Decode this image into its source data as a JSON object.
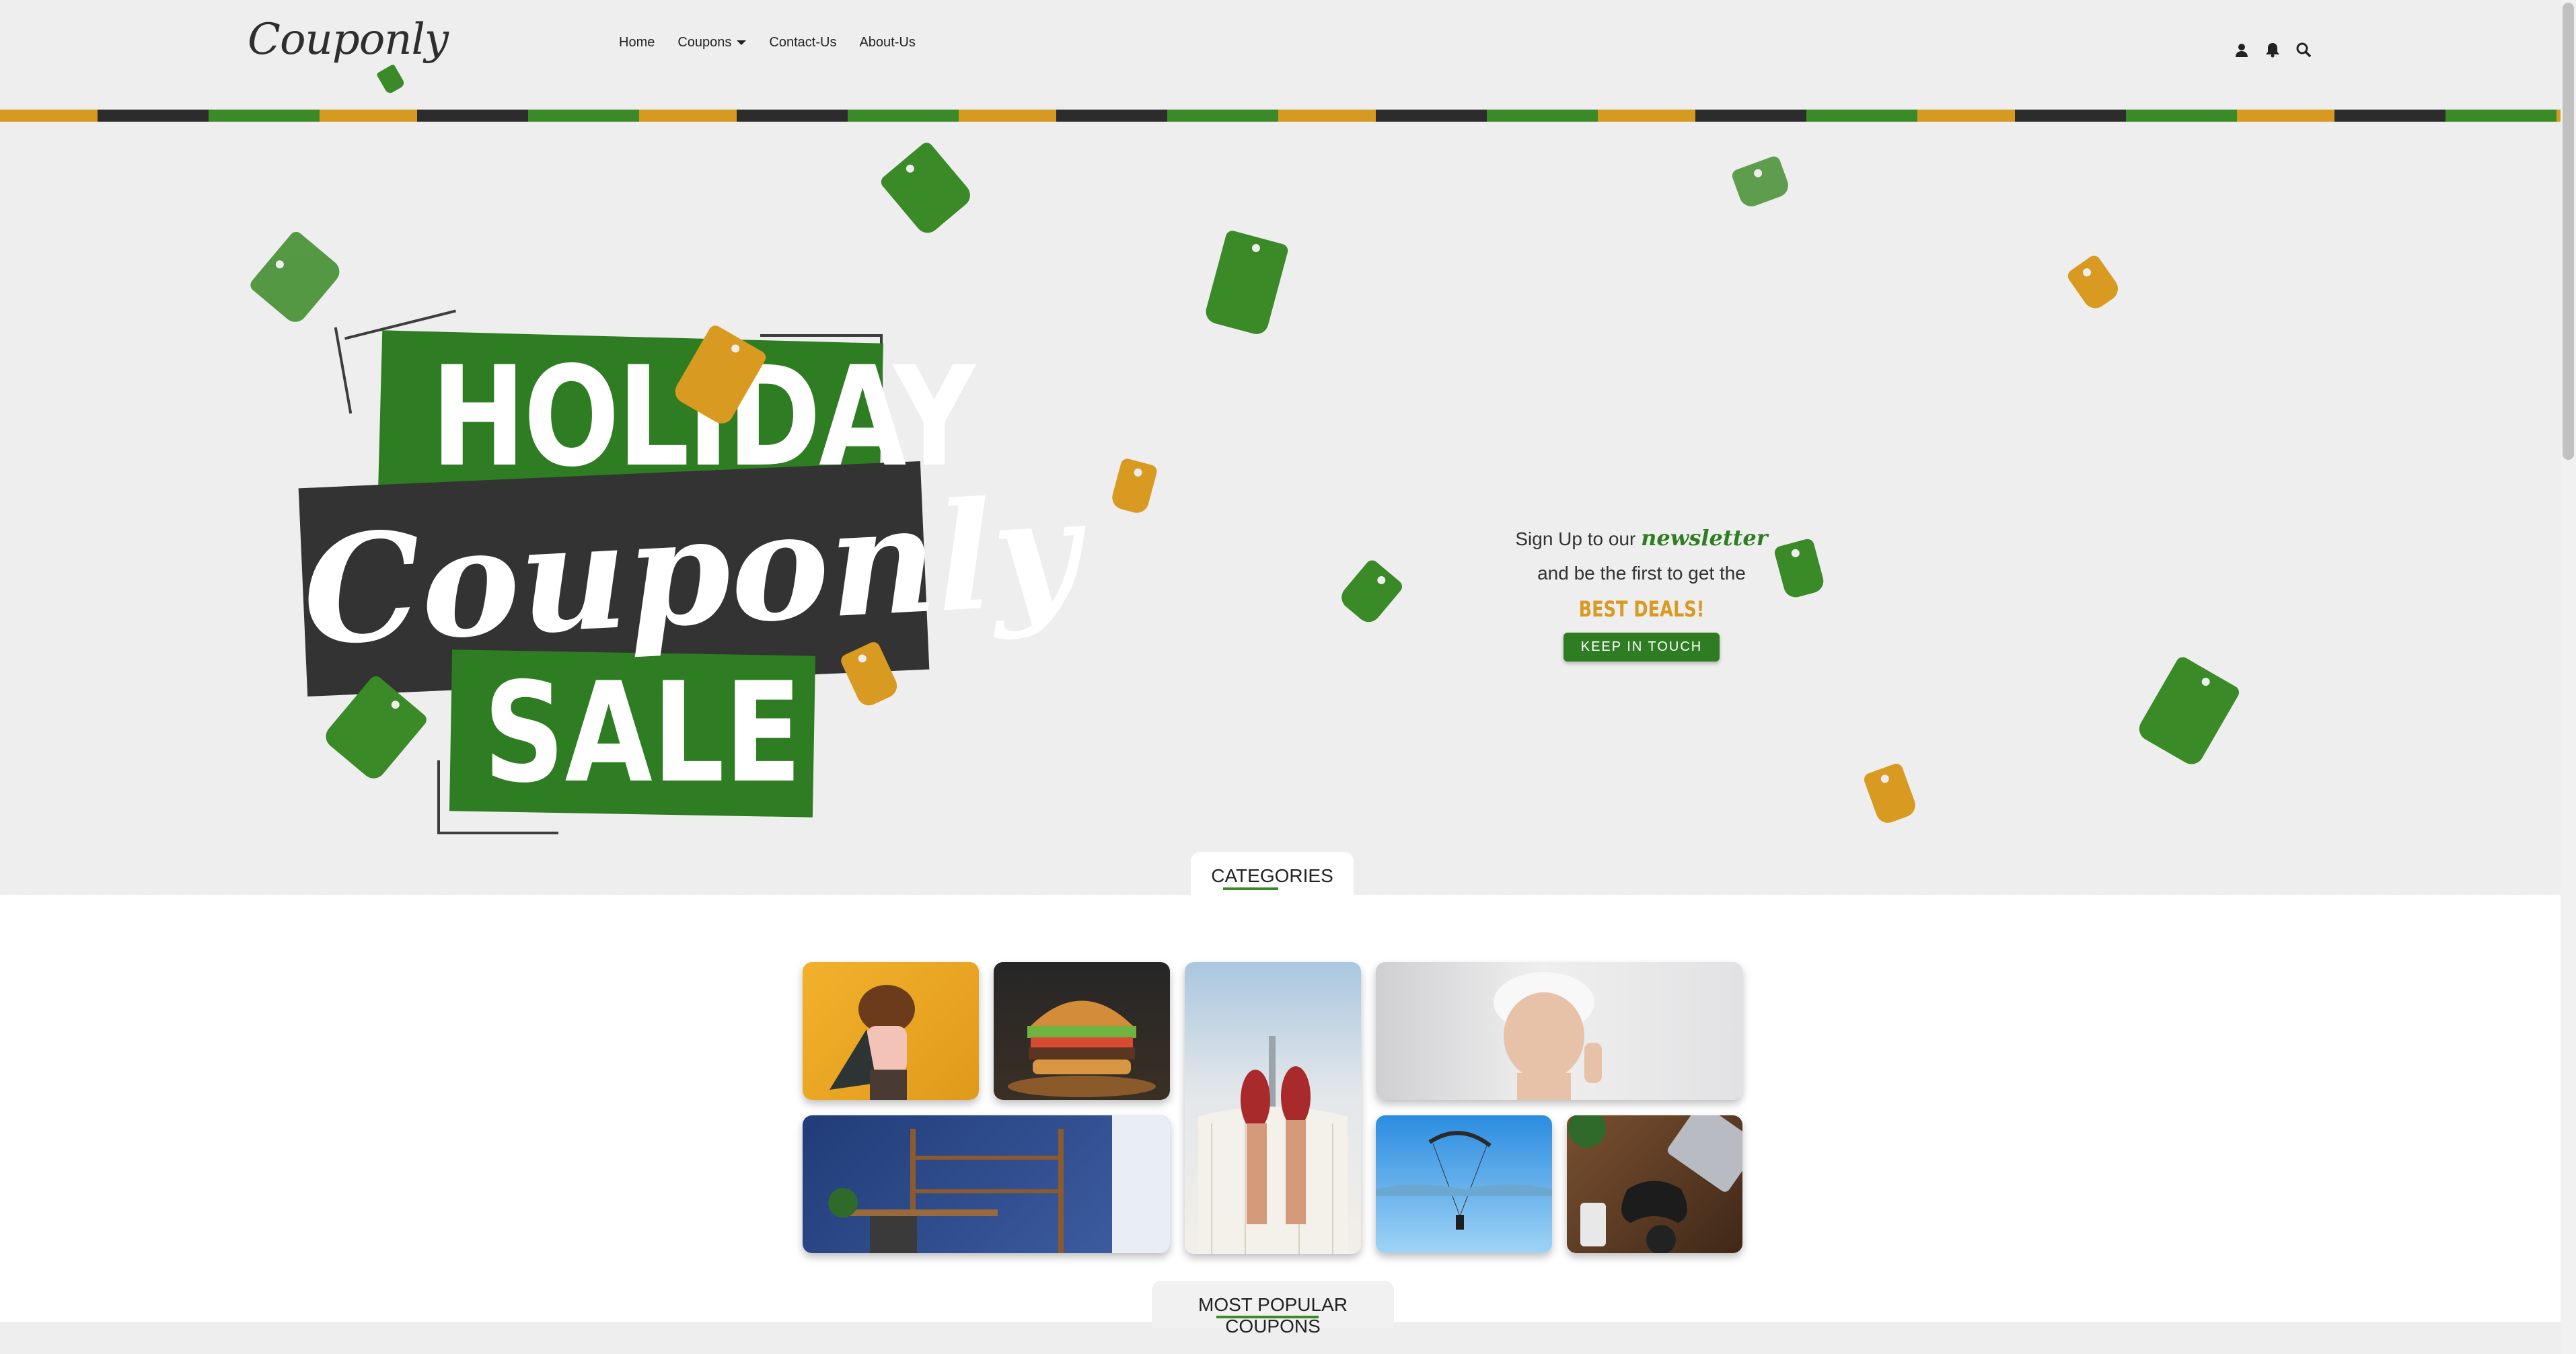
{
  "header": {
    "logo": "Couponly",
    "nav": [
      {
        "label": "Home"
      },
      {
        "label": "Coupons"
      },
      {
        "label": "Contact-Us"
      },
      {
        "label": "About-Us"
      }
    ],
    "tools": [
      "user-icon",
      "bell-icon",
      "search-icon"
    ]
  },
  "hero": {
    "banner": {
      "line1": "HOLIDAY",
      "line2": "Couponly",
      "line3": "SALE"
    },
    "newsletter": {
      "prefix": "Sign Up to our",
      "highlight": "newsletter",
      "line2": "and be the first to get the",
      "best": "BEST DEALS!",
      "button": "KEEP IN TOUCH"
    }
  },
  "categories": {
    "title": "CATEGORIES",
    "cards": [
      {
        "name": "superhero-kid",
        "colors": [
          "#f2b12c",
          "#e09a1a"
        ]
      },
      {
        "name": "burger",
        "colors": [
          "#2a2a2a",
          "#7a5a30"
        ]
      },
      {
        "name": "hammock-feet",
        "colors": [
          "#8fb7d6",
          "#ecebe6"
        ]
      },
      {
        "name": "spa-woman",
        "colors": [
          "#e9e9ea",
          "#cfcfd2"
        ]
      },
      {
        "name": "office-desk",
        "colors": [
          "#23417f",
          "#4a66a8"
        ]
      },
      {
        "name": "paraglider",
        "colors": [
          "#3c9be3",
          "#a9d6f5"
        ]
      },
      {
        "name": "gaming-desk",
        "colors": [
          "#6a4528",
          "#3b2617"
        ]
      }
    ]
  },
  "popular": {
    "title": "MOST POPULAR COUPONS"
  },
  "colors": {
    "green": "#3a8a27",
    "orange": "#d99a22",
    "dark": "#333333",
    "background": "#efeeee"
  }
}
